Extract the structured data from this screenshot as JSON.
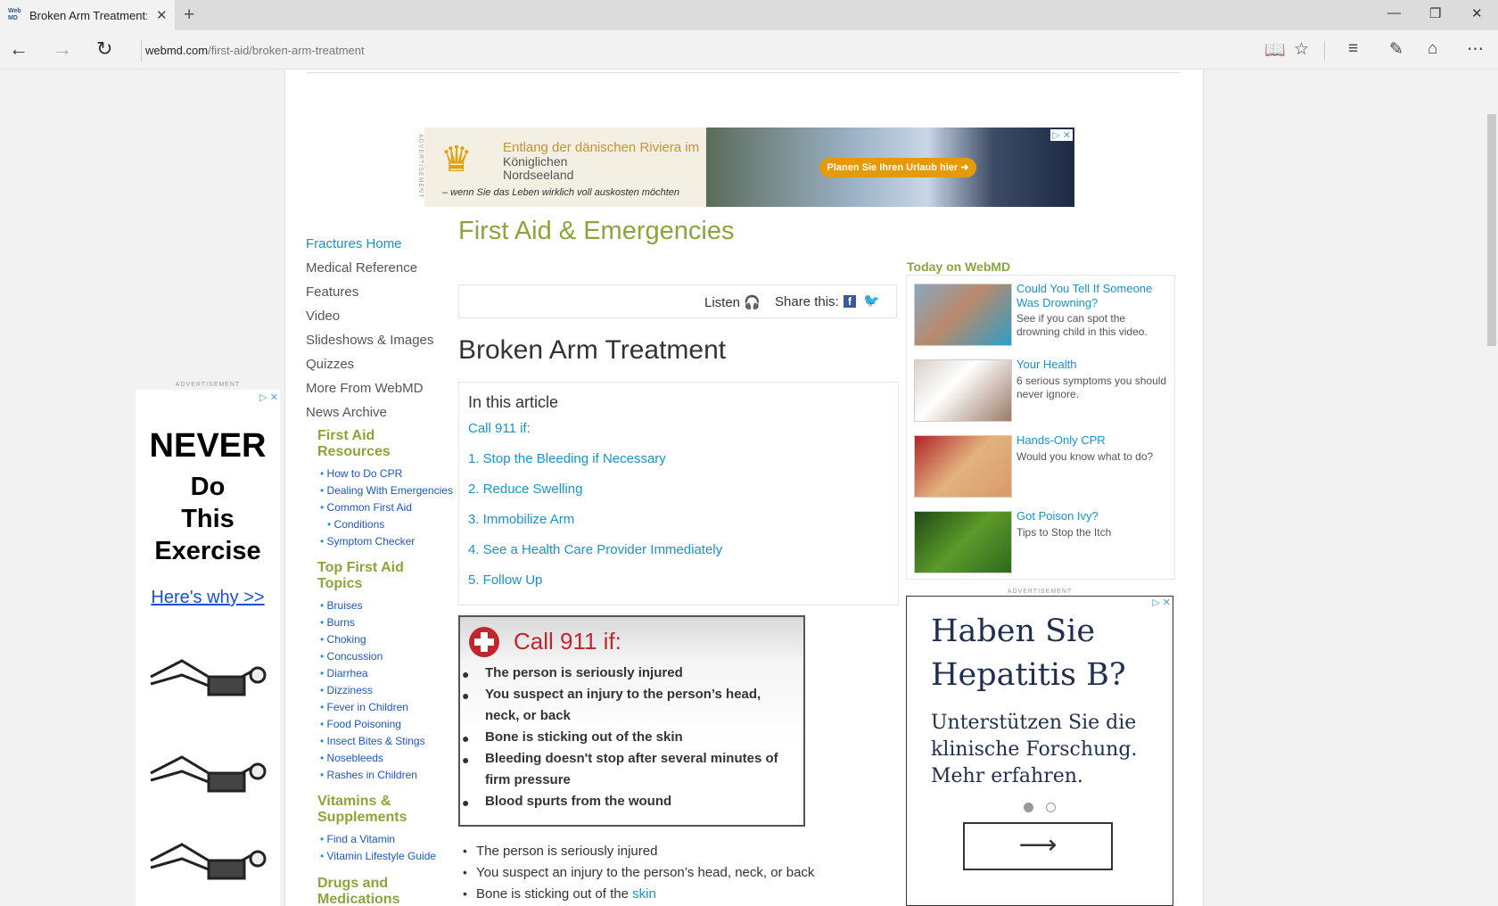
{
  "browser": {
    "tab_title": "Broken Arm Treatment:",
    "url_domain": "webmd.com",
    "url_path": "/first-aid/broken-arm-treatment"
  },
  "top_ad": {
    "advertisement_label": "ADVERTISEMENT",
    "line1": "Entlang der dänischen Riviera im",
    "line2": "Königlichen",
    "line3": "Nordseeland",
    "tagline": "– wenn Sie das Leben wirklich voll auskosten möchten",
    "cta": "Planen Sie Ihren Urlaub hier ➜"
  },
  "left_ad": {
    "advertisement_label": "ADVERTISEMENT",
    "line1": "NEVER",
    "line2": "Do",
    "line3": "This",
    "line4": "Exercise",
    "link": "Here's why >>"
  },
  "left_nav": {
    "items": [
      "Fractures Home",
      "Medical Reference",
      "Features",
      "Video",
      "Slideshows & Images",
      "Quizzes",
      "More From WebMD",
      "News Archive"
    ],
    "sections": [
      {
        "heading_lines": [
          "First Aid",
          "Resources"
        ],
        "links": [
          "How to Do CPR",
          "Dealing With Emergencies",
          "Common First Aid",
          "Conditions",
          "Symptom Checker"
        ]
      },
      {
        "heading_lines": [
          "Top First Aid",
          "Topics"
        ],
        "links": [
          "Bruises",
          "Burns",
          "Choking",
          "Concussion",
          "Diarrhea",
          "Dizziness",
          "Fever in Children",
          "Food Poisoning",
          "Insect Bites & Stings",
          "Nosebleeds",
          "Rashes in Children"
        ]
      },
      {
        "heading_lines": [
          "Vitamins &",
          "Supplements"
        ],
        "links": [
          "Find a Vitamin",
          "Vitamin Lifestyle Guide"
        ]
      },
      {
        "heading_lines": [
          "Drugs and",
          "Medications"
        ],
        "links": []
      }
    ]
  },
  "main": {
    "section_title": "First Aid & Emergencies",
    "listen": "Listen",
    "share": "Share this:",
    "article_title": "Broken Arm Treatment",
    "toc_title": "In this article",
    "toc_items": [
      "Call 911 if:",
      "1. Stop the Bleeding if Necessary",
      "2. Reduce Swelling",
      "3. Immobilize Arm",
      "4. See a Health Care Provider Immediately",
      "5. Follow Up"
    ],
    "callbox_title": "Call 911 if:",
    "callbox_items": [
      "The person is seriously injured",
      "You suspect an injury to the person’s head, neck, or back",
      "Bone is sticking out of the skin",
      "Bleeding doesn't stop after several minutes of firm pressure",
      "Blood spurts from the wound"
    ],
    "list_items": [
      "The person is seriously injured",
      "You suspect an injury to the person’s head, neck, or back"
    ],
    "list_item3_text": "Bone is sticking out of the ",
    "list_item3_link": "skin"
  },
  "today": {
    "heading": "Today on WebMD",
    "items": [
      {
        "title": "Could You Tell If Someone Was Drowning?",
        "desc": "See if you can spot the drowning child in this video."
      },
      {
        "title": "Your Health",
        "desc": "6 serious symptoms you should never ignore."
      },
      {
        "title": "Hands-Only CPR",
        "desc": "Would you know what to do?"
      },
      {
        "title": "Got Poison Ivy?",
        "desc": "Tips to Stop the Itch"
      }
    ]
  },
  "right_ad": {
    "advertisement_label": "ADVERTISEMENT",
    "headline": "Haben Sie Hepatitis B?",
    "body": "Unterstützen Sie die klinische Forschung. Mehr erfahren."
  },
  "colors": {
    "accent_green": "#8aa63a",
    "link_blue": "#1793cd",
    "alert_red": "#c0272d"
  }
}
